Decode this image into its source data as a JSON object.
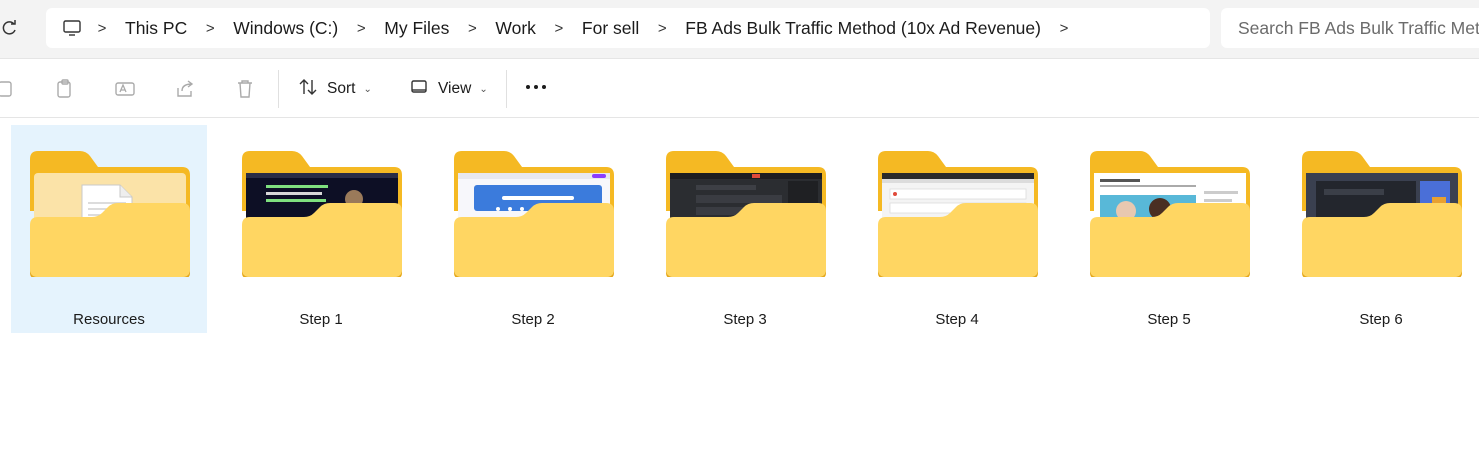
{
  "breadcrumb": {
    "items": [
      "This PC",
      "Windows (C:)",
      "My Files",
      "Work",
      "For sell",
      "FB Ads Bulk Traffic Method (10x Ad Revenue)"
    ]
  },
  "search": {
    "placeholder": "Search FB Ads Bulk Traffic Meth"
  },
  "toolbar": {
    "sort_label": "Sort",
    "view_label": "View"
  },
  "folders": [
    {
      "label": "Resources",
      "preview": "document",
      "selected": true
    },
    {
      "label": "Step 1",
      "preview": "webinar"
    },
    {
      "label": "Step 2",
      "preview": "design"
    },
    {
      "label": "Step 3",
      "preview": "dark-app"
    },
    {
      "label": "Step 4",
      "preview": "settings"
    },
    {
      "label": "Step 5",
      "preview": "photo"
    },
    {
      "label": "Step 6",
      "preview": "dark-desktop"
    }
  ],
  "colors": {
    "folder_back": "#f5b923",
    "folder_front": "#ffd662",
    "selection": "#e5f3fd",
    "chrome": "#f3f3f3"
  }
}
